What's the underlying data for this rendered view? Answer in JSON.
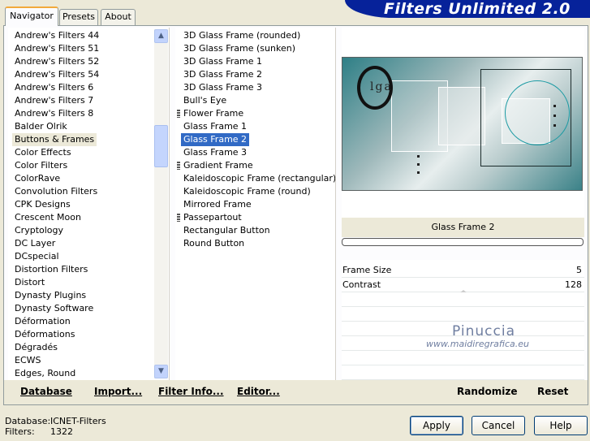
{
  "window": {
    "title": "Filters Unlimited 2.0"
  },
  "tabs": [
    {
      "label": "Navigator",
      "active": true
    },
    {
      "label": "Presets",
      "active": false
    },
    {
      "label": "About",
      "active": false
    }
  ],
  "filter_list": {
    "selected": "Buttons & Frames",
    "items": [
      "Andrew's Filters 44",
      "Andrew's Filters 51",
      "Andrew's Filters 52",
      "Andrew's Filters 54",
      "Andrew's Filters 6",
      "Andrew's Filters 7",
      "Andrew's Filters 8",
      "Balder Olrik",
      "Buttons & Frames",
      "Color Effects",
      "Color Filters",
      "ColorRave",
      "Convolution Filters",
      "CPK Designs",
      "Crescent Moon",
      "Cryptology",
      "DC Layer",
      "DCspecial",
      "Distortion Filters",
      "Distort",
      "Dynasty Plugins",
      "Dynasty Software",
      "Déformation",
      "Déformations",
      "Dégradés",
      "ECWS",
      "Edges, Round"
    ]
  },
  "effect_list": {
    "selected": "Glass Frame 2",
    "items": [
      {
        "label": "3D Glass Frame (rounded)",
        "grip": false
      },
      {
        "label": "3D Glass Frame (sunken)",
        "grip": false
      },
      {
        "label": "3D Glass Frame 1",
        "grip": false
      },
      {
        "label": "3D Glass Frame 2",
        "grip": false
      },
      {
        "label": "3D Glass Frame 3",
        "grip": false
      },
      {
        "label": "Bull's Eye",
        "grip": false
      },
      {
        "label": "Flower Frame",
        "grip": true
      },
      {
        "label": "Glass Frame 1",
        "grip": false
      },
      {
        "label": "Glass Frame 2",
        "grip": false
      },
      {
        "label": "Glass Frame 3",
        "grip": false
      },
      {
        "label": "Gradient Frame",
        "grip": true
      },
      {
        "label": "Kaleidoscopic Frame (rectangular)",
        "grip": false
      },
      {
        "label": "Kaleidoscopic Frame (round)",
        "grip": false
      },
      {
        "label": "Mirrored Frame",
        "grip": false
      },
      {
        "label": "Passepartout",
        "grip": true
      },
      {
        "label": "Rectangular Button",
        "grip": false
      },
      {
        "label": "Round Button",
        "grip": false
      }
    ]
  },
  "preview": {
    "effect_name": "Glass Frame 2",
    "image_text": "lga"
  },
  "params": [
    {
      "label": "Frame Size",
      "value": "5"
    },
    {
      "label": "Contrast",
      "value": "128"
    }
  ],
  "watermark": {
    "name": "Pinuccia",
    "url": "www.maidiregrafica.eu"
  },
  "panel_buttons": {
    "database": "Database",
    "import": "Import...",
    "filter_info": "Filter Info...",
    "editor": "Editor...",
    "randomize": "Randomize",
    "reset": "Reset"
  },
  "status": {
    "database_label": "Database:",
    "database_value": "ICNET-Filters",
    "filters_label": "Filters:",
    "filters_value": "1322"
  },
  "dialog_buttons": {
    "apply": "Apply",
    "cancel": "Cancel",
    "help": "Help"
  },
  "colors": {
    "banner": "#06229a",
    "selection": "#316ac5",
    "tab_accent": "#f2a93b"
  }
}
